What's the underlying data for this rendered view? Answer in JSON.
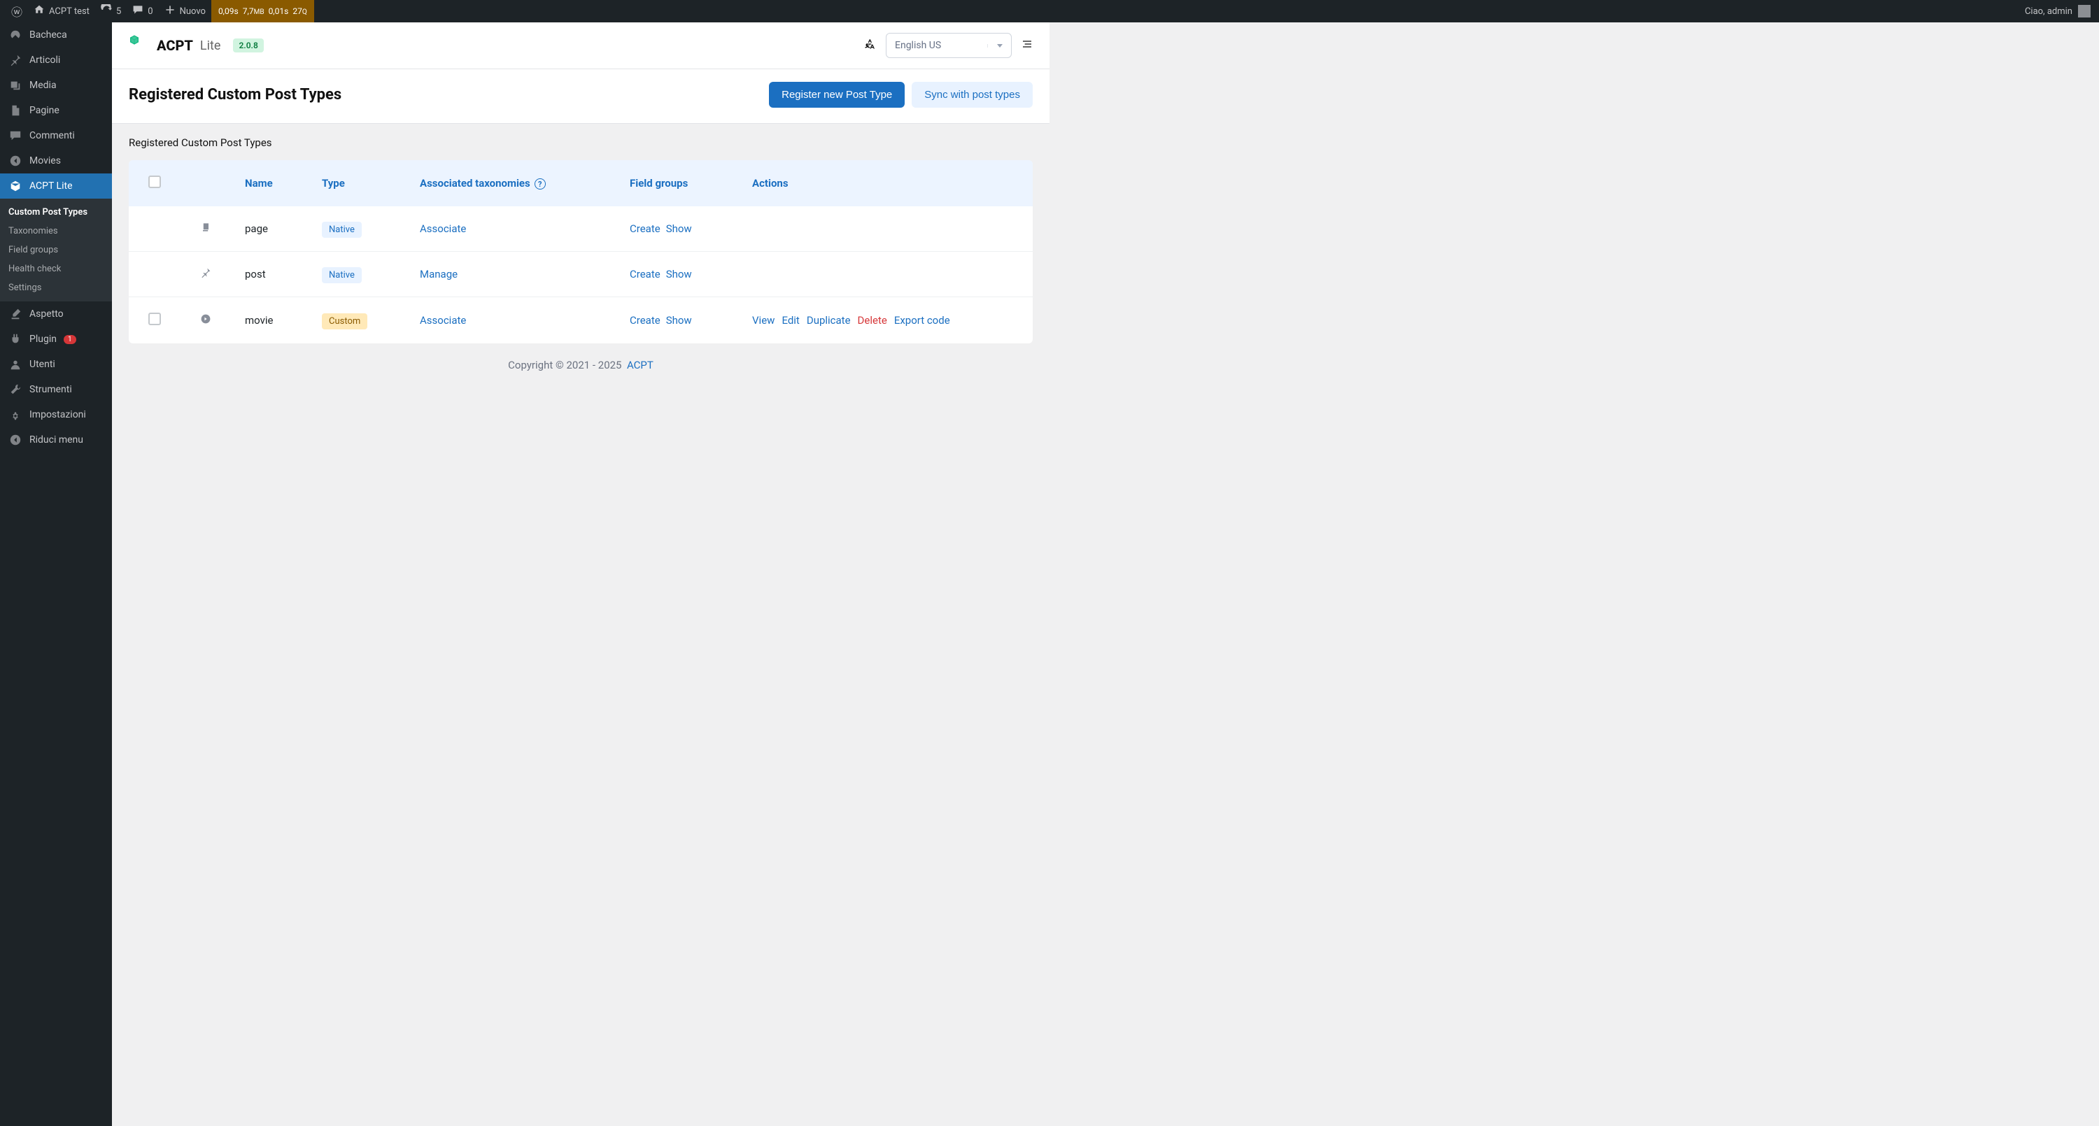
{
  "adminbar": {
    "site_name": "ACPT test",
    "updates": "5",
    "comments": "0",
    "new_label": "Nuovo",
    "qm": {
      "time1": "0,09s",
      "mem": "7,7",
      "mem_unit": "MB",
      "time2": "0,01s",
      "queries": "27",
      "queries_unit": "Q"
    },
    "greeting": "Ciao, admin"
  },
  "sidebar": {
    "items": [
      {
        "label": "Bacheca",
        "icon": "dashboard"
      },
      {
        "label": "Articoli",
        "icon": "pin"
      },
      {
        "label": "Media",
        "icon": "media"
      },
      {
        "label": "Pagine",
        "icon": "page"
      },
      {
        "label": "Commenti",
        "icon": "comment"
      },
      {
        "label": "Movies",
        "icon": "arrow-left"
      },
      {
        "label": "ACPT Lite",
        "icon": "box",
        "active": true,
        "children": [
          {
            "label": "Custom Post Types",
            "current": true
          },
          {
            "label": "Taxonomies"
          },
          {
            "label": "Field groups"
          },
          {
            "label": "Health check"
          },
          {
            "label": "Settings"
          }
        ]
      },
      {
        "label": "Aspetto",
        "icon": "brush"
      },
      {
        "label": "Plugin",
        "icon": "plugin",
        "badge": "1"
      },
      {
        "label": "Utenti",
        "icon": "user"
      },
      {
        "label": "Strumenti",
        "icon": "wrench"
      },
      {
        "label": "Impostazioni",
        "icon": "settings"
      },
      {
        "label": "Riduci menu",
        "icon": "arrow-left"
      }
    ]
  },
  "header": {
    "brand_strong": "ACPT",
    "brand_lite": "Lite",
    "version": "2.0.8",
    "language": "English US"
  },
  "page": {
    "title": "Registered Custom Post Types",
    "btn_register": "Register new Post Type",
    "btn_sync": "Sync with post types",
    "subheading": "Registered Custom Post Types"
  },
  "table": {
    "headers": {
      "name": "Name",
      "type": "Type",
      "tax": "Associated taxonomies",
      "fields": "Field groups",
      "actions": "Actions"
    },
    "rows": [
      {
        "icon": "copy",
        "name": "page",
        "type_label": "Native",
        "type_kind": "native",
        "tax_link": "Associate",
        "field_links": [
          "Create",
          "Show"
        ],
        "checkbox": false,
        "action_links": []
      },
      {
        "icon": "pin",
        "name": "post",
        "type_label": "Native",
        "type_kind": "native",
        "tax_link": "Manage",
        "field_links": [
          "Create",
          "Show"
        ],
        "checkbox": false,
        "action_links": []
      },
      {
        "icon": "play-circle",
        "name": "movie",
        "type_label": "Custom",
        "type_kind": "custom",
        "tax_link": "Associate",
        "field_links": [
          "Create",
          "Show"
        ],
        "checkbox": true,
        "action_links": [
          {
            "label": "View",
            "kind": "normal"
          },
          {
            "label": "Edit",
            "kind": "normal"
          },
          {
            "label": "Duplicate",
            "kind": "normal"
          },
          {
            "label": "Delete",
            "kind": "danger"
          },
          {
            "label": "Export code",
            "kind": "normal"
          }
        ]
      }
    ]
  },
  "footer": {
    "copyright": "Copyright © 2021 - 2025",
    "link": "ACPT"
  }
}
